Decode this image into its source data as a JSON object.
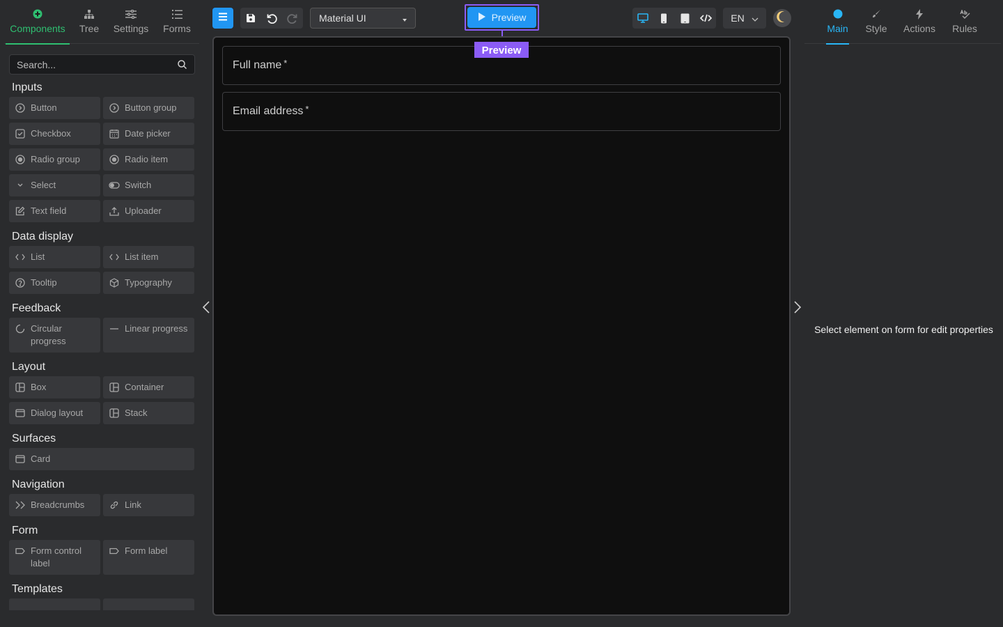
{
  "left_tabs": [
    {
      "label": "Components",
      "icon": "components-icon"
    },
    {
      "label": "Tree",
      "icon": "tree-icon"
    },
    {
      "label": "Settings",
      "icon": "settings-icon"
    },
    {
      "label": "Forms",
      "icon": "forms-icon"
    }
  ],
  "search": {
    "placeholder": "Search..."
  },
  "groups": [
    {
      "title": "Inputs",
      "items": [
        {
          "label": "Button",
          "icon": "button-icon"
        },
        {
          "label": "Button group",
          "icon": "button-group-icon"
        },
        {
          "label": "Checkbox",
          "icon": "checkbox-icon"
        },
        {
          "label": "Date picker",
          "icon": "calendar-icon"
        },
        {
          "label": "Radio group",
          "icon": "radio-icon"
        },
        {
          "label": "Radio item",
          "icon": "radio-icon"
        },
        {
          "label": "Select",
          "icon": "chevron-down-icon"
        },
        {
          "label": "Switch",
          "icon": "toggle-icon"
        },
        {
          "label": "Text field",
          "icon": "edit-icon"
        },
        {
          "label": "Uploader",
          "icon": "upload-icon"
        }
      ]
    },
    {
      "title": "Data display",
      "items": [
        {
          "label": "List",
          "icon": "code-icon"
        },
        {
          "label": "List item",
          "icon": "code-icon"
        },
        {
          "label": "Tooltip",
          "icon": "help-icon"
        },
        {
          "label": "Typography",
          "icon": "cube-icon"
        }
      ]
    },
    {
      "title": "Feedback",
      "items": [
        {
          "label": "Circular progress",
          "icon": "circle-progress-icon"
        },
        {
          "label": "Linear progress",
          "icon": "minus-icon"
        }
      ]
    },
    {
      "title": "Layout",
      "items": [
        {
          "label": "Box",
          "icon": "layout-icon"
        },
        {
          "label": "Container",
          "icon": "layout-icon"
        },
        {
          "label": "Dialog layout",
          "icon": "window-icon"
        },
        {
          "label": "Stack",
          "icon": "layout-icon"
        }
      ]
    },
    {
      "title": "Surfaces",
      "items": [
        {
          "label": "Card",
          "icon": "window-icon"
        }
      ]
    },
    {
      "title": "Navigation",
      "items": [
        {
          "label": "Breadcrumbs",
          "icon": "double-chevron-icon"
        },
        {
          "label": "Link",
          "icon": "link-icon"
        }
      ]
    },
    {
      "title": "Form",
      "items": [
        {
          "label": "Form control label",
          "icon": "tag-icon"
        },
        {
          "label": "Form label",
          "icon": "tag-icon"
        }
      ]
    },
    {
      "title": "Templates",
      "items": []
    }
  ],
  "toolbar": {
    "library": "Material UI",
    "preview_label": "Preview",
    "preview_tag": "Preview",
    "language": "EN"
  },
  "canvas": {
    "fields": [
      {
        "label": "Full name",
        "required_mark": "*"
      },
      {
        "label": "Email address",
        "required_mark": "*"
      }
    ]
  },
  "right_tabs": [
    {
      "label": "Main",
      "icon": "dot-icon"
    },
    {
      "label": "Style",
      "icon": "brush-icon"
    },
    {
      "label": "Actions",
      "icon": "bolt-icon"
    },
    {
      "label": "Rules",
      "icon": "rules-icon"
    }
  ],
  "right_panel": {
    "empty_message": "Select element on form for edit properties"
  },
  "colors": {
    "accent_green": "#2fbf71",
    "accent_blue": "#2196f3",
    "highlight_purple": "#8b5cf6"
  }
}
